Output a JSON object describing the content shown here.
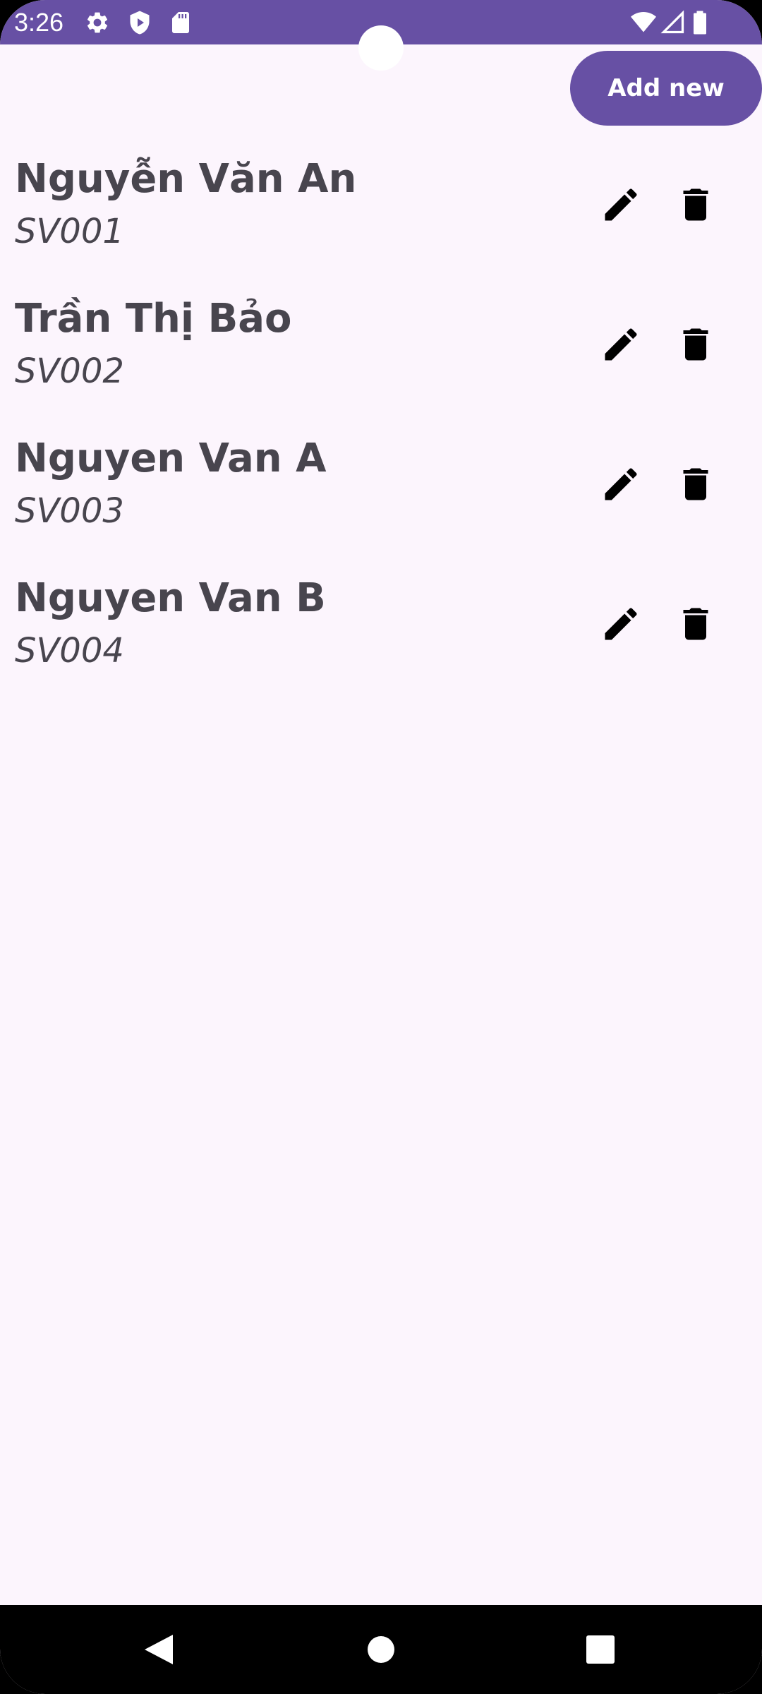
{
  "status_bar": {
    "time": "3:26",
    "background": "#6750a4",
    "left_icons": [
      "settings-icon",
      "shield-play-icon",
      "sd-card-icon"
    ],
    "right_icons": [
      "wifi-icon",
      "cell-signal-icon",
      "battery-icon"
    ]
  },
  "toolbar": {
    "add_button_label": "Add new"
  },
  "students": [
    {
      "name": "Nguyễn Văn An",
      "id": "SV001"
    },
    {
      "name": "Trần Thị Bảo",
      "id": "SV002"
    },
    {
      "name": "Nguyen Van A",
      "id": "SV003"
    },
    {
      "name": "Nguyen Van B",
      "id": "SV004"
    }
  ],
  "row_actions": [
    "edit-icon",
    "delete-icon"
  ],
  "colors": {
    "accent": "#6750a4",
    "background": "#fcf5fd",
    "text": "#48454e"
  },
  "nav_bar": {
    "buttons": [
      "back-icon",
      "home-icon",
      "recents-icon"
    ]
  }
}
